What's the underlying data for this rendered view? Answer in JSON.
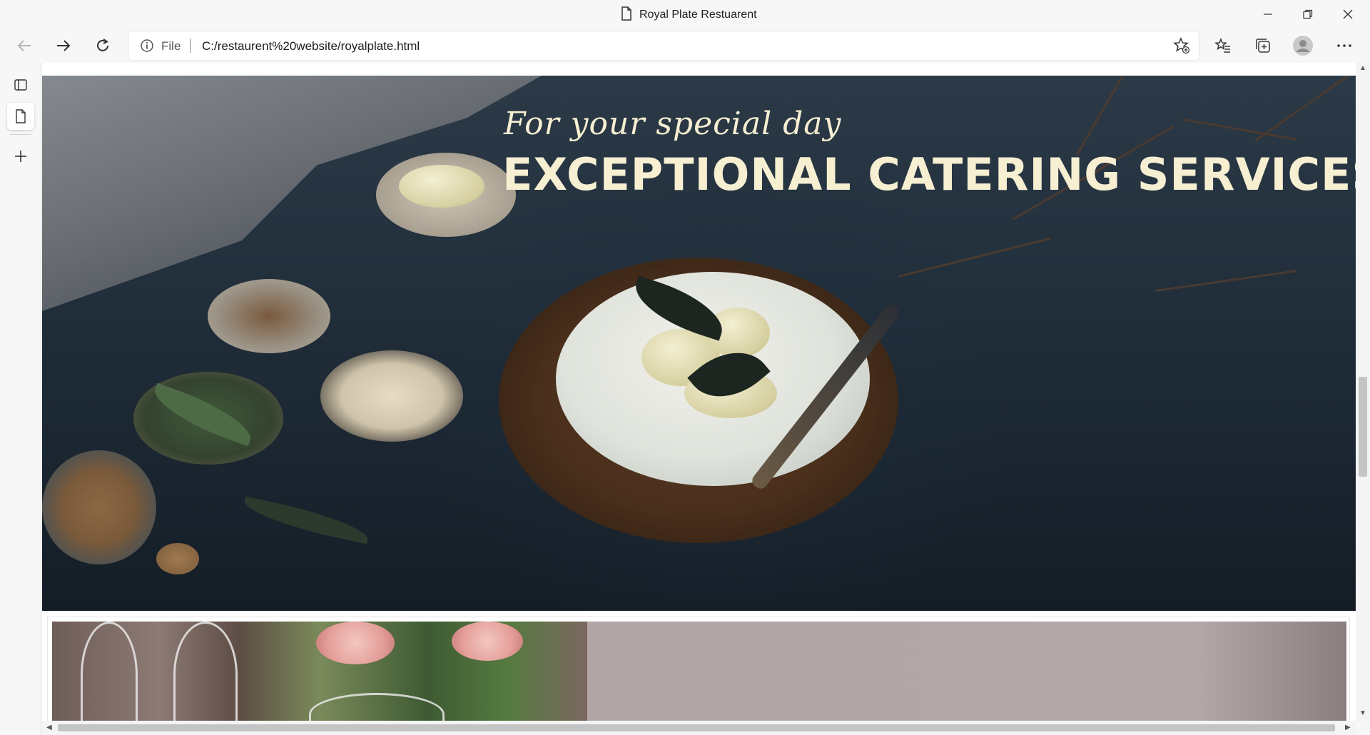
{
  "window": {
    "title": "Royal Plate Restuarent"
  },
  "toolbar": {
    "file_label": "File",
    "url": "C:/restaurent%20website/royalplate.html"
  },
  "hero": {
    "subtitle": "For your special day",
    "title": "EXCEPTIONAL CATERING SERVICES"
  },
  "colors": {
    "hero_text": "#f6efd2",
    "hero_bg": "#1f2c38",
    "panel_bg": "#b2a6a6"
  },
  "icons": {
    "title": "page-icon",
    "back": "arrow-left-icon",
    "forward": "arrow-right-icon",
    "refresh": "refresh-icon",
    "info": "info-icon",
    "add_favorite": "star-plus-icon",
    "favorites": "favorites-icon",
    "collections": "collections-icon",
    "profile": "profile-icon",
    "more": "more-icon",
    "tab_actions": "tab-actions-icon",
    "new_tab": "plus-icon"
  }
}
